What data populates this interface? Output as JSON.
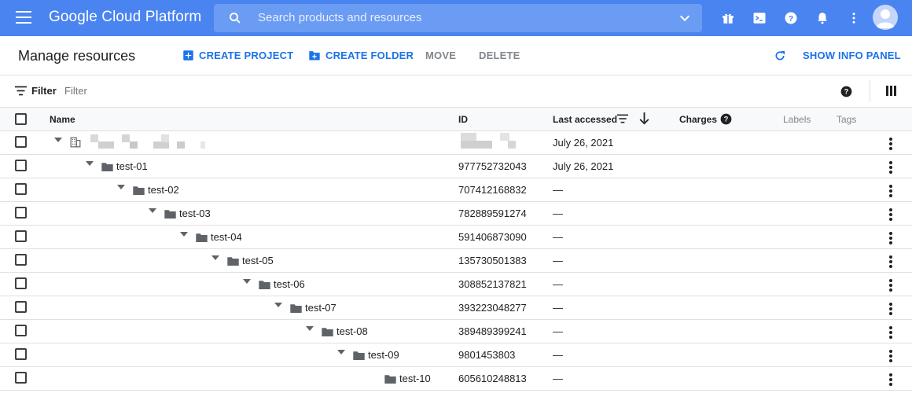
{
  "app": {
    "brand": "Google Cloud Platform",
    "search_placeholder": "Search products and resources",
    "colors": {
      "topbar": "#4a84f0",
      "accent": "#1a73e8"
    },
    "top_icons": [
      "gift-icon",
      "cloud-shell-icon",
      "help-icon",
      "notifications-icon",
      "more-vert-icon",
      "account-avatar"
    ]
  },
  "page": {
    "title": "Manage resources",
    "actions": {
      "create_project": "CREATE PROJECT",
      "create_folder": "CREATE FOLDER",
      "move": "MOVE",
      "delete": "DELETE",
      "show_info_panel": "SHOW INFO PANEL"
    }
  },
  "filter": {
    "label": "Filter",
    "placeholder": "Filter"
  },
  "table": {
    "headers": {
      "name": "Name",
      "id": "ID",
      "last_accessed": "Last accessed",
      "charges": "Charges",
      "labels": "Labels",
      "tags": "Tags"
    },
    "rows": [
      {
        "name": "",
        "id": "",
        "last_accessed": "July 26, 2021",
        "type": "organization",
        "redacted": true
      },
      {
        "name": "test-01",
        "id": "977752732043",
        "last_accessed": "July 26, 2021",
        "type": "folder"
      },
      {
        "name": "test-02",
        "id": "707412168832",
        "last_accessed": "—",
        "type": "folder"
      },
      {
        "name": "test-03",
        "id": "782889591274",
        "last_accessed": "—",
        "type": "folder"
      },
      {
        "name": "test-04",
        "id": "591406873090",
        "last_accessed": "—",
        "type": "folder"
      },
      {
        "name": "test-05",
        "id": "135730501383",
        "last_accessed": "—",
        "type": "folder"
      },
      {
        "name": "test-06",
        "id": "308852137821",
        "last_accessed": "—",
        "type": "folder"
      },
      {
        "name": "test-07",
        "id": "393223048277",
        "last_accessed": "—",
        "type": "folder"
      },
      {
        "name": "test-08",
        "id": "389489399241",
        "last_accessed": "—",
        "type": "folder"
      },
      {
        "name": "test-09",
        "id": "9801453803",
        "last_accessed": "—",
        "type": "folder"
      },
      {
        "name": "test-10",
        "id": "605610248813",
        "last_accessed": "—",
        "type": "folder"
      }
    ]
  }
}
